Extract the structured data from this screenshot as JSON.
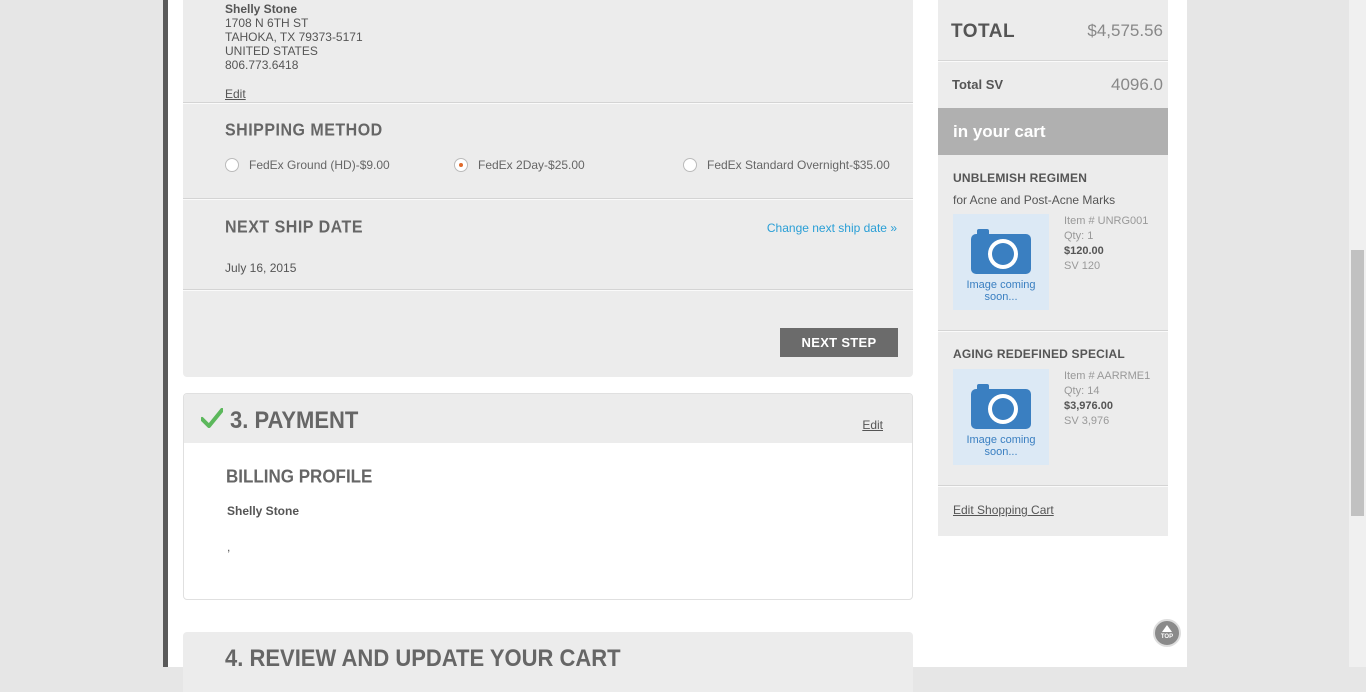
{
  "shipping_address": {
    "name": "Shelly Stone",
    "line1": "1708 N 6TH ST",
    "line2": "TAHOKA, TX 79373-5171",
    "country": "UNITED STATES",
    "phone": "806.773.6418",
    "edit_label": "Edit"
  },
  "shipping_method": {
    "title": "SHIPPING METHOD",
    "options": [
      {
        "label": "FedEx Ground (HD)-$9.00",
        "selected": false
      },
      {
        "label": "FedEx 2Day-$25.00",
        "selected": true
      },
      {
        "label": "FedEx Standard Overnight-$35.00",
        "selected": false
      }
    ]
  },
  "next_ship": {
    "title": "NEXT SHIP DATE",
    "change_label": "Change next ship date »",
    "date": "July 16, 2015"
  },
  "next_step_label": "NEXT STEP",
  "payment": {
    "title": "3. PAYMENT",
    "edit_label": "Edit",
    "billing_title": "BILLING PROFILE",
    "billing_name": "Shelly Stone",
    "billing_line": ","
  },
  "review": {
    "title": "4. REVIEW AND UPDATE YOUR CART"
  },
  "summary": {
    "total_label": "TOTAL",
    "total_value": "$4,575.56",
    "sv_label": "Total SV",
    "sv_value": "4096.0",
    "cart_header": "in your cart",
    "edit_cart_label": "Edit Shopping Cart",
    "items": [
      {
        "title": "UNBLEMISH REGIMEN",
        "subtitle": "for Acne and Post-Acne Marks",
        "image_text": "Image coming soon...",
        "item_no": "Item # UNRG001",
        "qty": "Qty: 1",
        "price": "$120.00",
        "sv": "SV 120"
      },
      {
        "title": "AGING REDEFINED SPECIAL",
        "subtitle": "",
        "image_text": "Image coming soon...",
        "item_no": "Item # AARRME1",
        "qty": "Qty: 14",
        "price": "$3,976.00",
        "sv": "SV 3,976"
      }
    ]
  },
  "top_button_label": "TOP",
  "colors": {
    "accent_link": "#2a9fd6",
    "radio_selected": "#e06a2b",
    "check_green": "#5cb85c",
    "button_dark": "#6b6b6b"
  }
}
